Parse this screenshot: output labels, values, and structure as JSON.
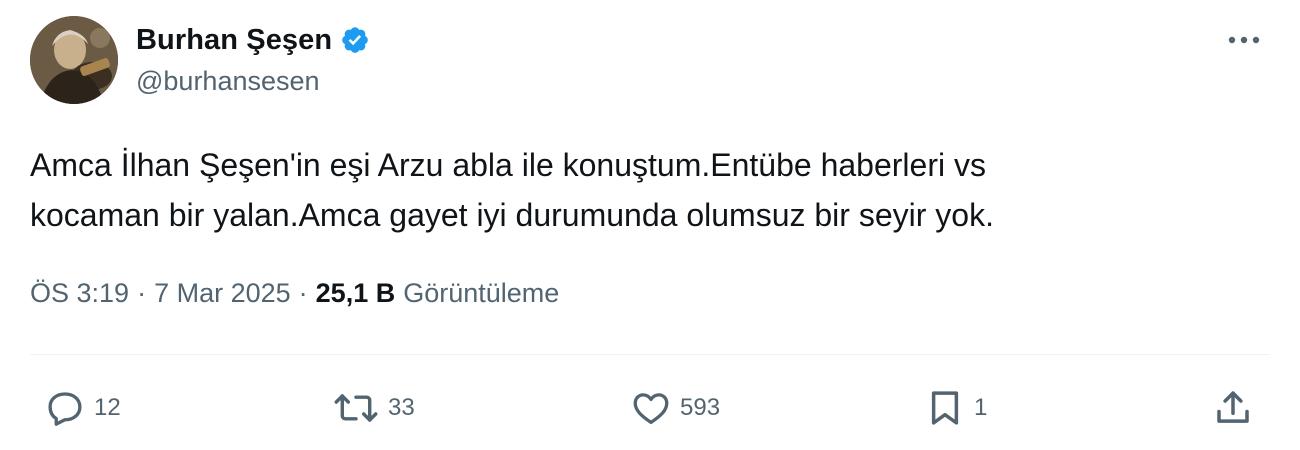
{
  "user": {
    "display_name": "Burhan Şeşen",
    "handle": "@burhansesen",
    "verified": true,
    "verified_color": "#1d9bf0"
  },
  "tweet": {
    "text_line1": "Amca İlhan Şeşen'in eşi Arzu abla ile konuştum.Entübe haberleri vs",
    "text_line2": "kocaman bir yalan.Amca gayet iyi durumunda olumsuz bir seyir yok.",
    "time": "ÖS 3:19",
    "separator1": "·",
    "date": "7 Mar 2025",
    "separator2": "·",
    "views_count": "25,1 B",
    "views_label": "Görüntüleme"
  },
  "actions": {
    "reply_count": "12",
    "retweet_count": "33",
    "like_count": "593",
    "bookmark_count": "1"
  },
  "icons": {
    "avatar": "avatar",
    "verified": "verified-badge-icon",
    "more": "more-options-icon",
    "reply": "reply-icon",
    "retweet": "retweet-icon",
    "like": "heart-icon",
    "bookmark": "bookmark-icon",
    "share": "share-icon"
  },
  "colors": {
    "text_primary": "#0f1419",
    "text_secondary": "#536471",
    "divider": "#eff3f4",
    "accent": "#1d9bf0"
  }
}
